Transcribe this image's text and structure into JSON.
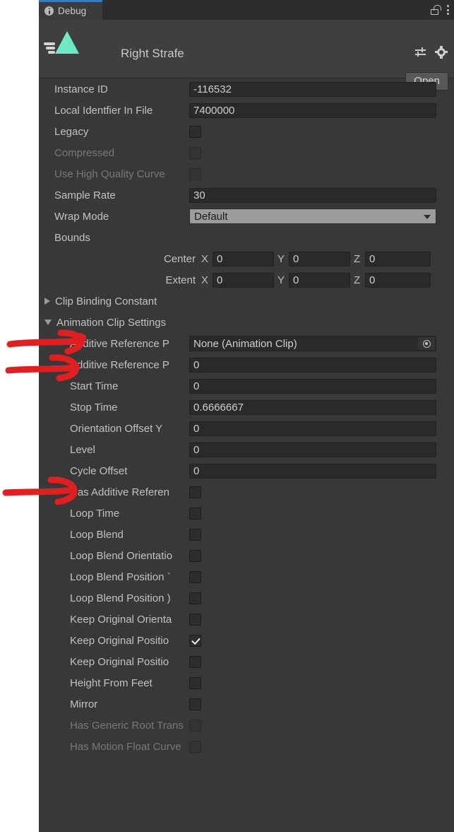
{
  "window": {
    "tab_label": "Debug",
    "tab_icon": "info-icon",
    "lock_icon": "lock-icon",
    "menu_icon": "kebab-menu-icon"
  },
  "header": {
    "object_name": "Right Strafe",
    "object_icon": "animation-clip-icon",
    "preset_icon": "preset-selector-icon",
    "settings_icon": "gear-icon",
    "open_label": "Open"
  },
  "properties": [
    {
      "label": "Instance ID",
      "type": "text",
      "value": "-116532",
      "disabled": false,
      "indent": 0
    },
    {
      "label": "Local Identfier In File",
      "type": "text",
      "value": "7400000",
      "disabled": false,
      "indent": 0
    },
    {
      "label": "Legacy",
      "type": "checkbox",
      "checked": false,
      "disabled": false,
      "indent": 0
    },
    {
      "label": "Compressed",
      "type": "checkbox",
      "checked": false,
      "disabled": true,
      "indent": 0
    },
    {
      "label": "Use High Quality Curve",
      "type": "checkbox",
      "checked": false,
      "disabled": true,
      "indent": 0
    },
    {
      "label": "Sample Rate",
      "type": "text",
      "value": "30",
      "disabled": false,
      "indent": 0
    },
    {
      "label": "Wrap Mode",
      "type": "dropdown",
      "value": "Default",
      "disabled": false,
      "indent": 0
    },
    {
      "label": "Bounds",
      "type": "header",
      "disabled": false,
      "indent": 0
    }
  ],
  "bounds": [
    {
      "label": "Center",
      "x": "0",
      "y": "0",
      "z": "0"
    },
    {
      "label": "Extent",
      "x": "0",
      "y": "0",
      "z": "0"
    }
  ],
  "foldouts": [
    {
      "label": "Clip Binding Constant",
      "expanded": false
    },
    {
      "label": "Animation Clip Settings",
      "expanded": true
    }
  ],
  "clip_settings": [
    {
      "label": "Additive Reference P",
      "type": "object",
      "value": "None (Animation Clip)",
      "disabled": false
    },
    {
      "label": "Additive Reference P",
      "type": "text",
      "value": "0",
      "disabled": false
    },
    {
      "label": "Start Time",
      "type": "text",
      "value": "0",
      "disabled": false
    },
    {
      "label": "Stop Time",
      "type": "text",
      "value": "0.6666667",
      "disabled": false
    },
    {
      "label": "Orientation Offset Y",
      "type": "text",
      "value": "0",
      "disabled": false
    },
    {
      "label": "Level",
      "type": "text",
      "value": "0",
      "disabled": false
    },
    {
      "label": "Cycle Offset",
      "type": "text",
      "value": "0",
      "disabled": false
    },
    {
      "label": "Has Additive Referen",
      "type": "checkbox",
      "checked": false,
      "disabled": false
    },
    {
      "label": "Loop Time",
      "type": "checkbox",
      "checked": false,
      "disabled": false
    },
    {
      "label": "Loop Blend",
      "type": "checkbox",
      "checked": false,
      "disabled": false
    },
    {
      "label": "Loop Blend Orientatio",
      "type": "checkbox",
      "checked": false,
      "disabled": false
    },
    {
      "label": "Loop Blend Position `",
      "type": "checkbox",
      "checked": false,
      "disabled": false
    },
    {
      "label": "Loop Blend Position )",
      "type": "checkbox",
      "checked": false,
      "disabled": false
    },
    {
      "label": "Keep Original Orienta",
      "type": "checkbox",
      "checked": false,
      "disabled": false
    },
    {
      "label": "Keep Original Positio",
      "type": "checkbox",
      "checked": true,
      "disabled": false
    },
    {
      "label": "Keep Original Positio",
      "type": "checkbox",
      "checked": false,
      "disabled": false
    },
    {
      "label": "Height From Feet",
      "type": "checkbox",
      "checked": false,
      "disabled": false
    },
    {
      "label": "Mirror",
      "type": "checkbox",
      "checked": false,
      "disabled": false
    },
    {
      "label": "Has Generic Root Trans",
      "type": "checkbox",
      "checked": false,
      "disabled": true
    },
    {
      "label": "Has Motion Float Curve",
      "type": "checkbox",
      "checked": false,
      "disabled": true
    }
  ],
  "annotations": {
    "arrow_color": "#e02020",
    "arrow_targets": [
      "Additive Reference Pose Clip",
      "Additive Reference Pose Time",
      "Has Additive Reference Pose"
    ]
  },
  "colors": {
    "panel_bg": "#383838",
    "header_bg": "#3f3f3f",
    "tabbar_bg": "#2d2d2d",
    "tab_active_accent": "#3a79bb",
    "field_bg": "#2a2a2a",
    "clip_icon": "#6fe8c4",
    "label": "#c2c2c2",
    "label_disabled": "#787878"
  }
}
